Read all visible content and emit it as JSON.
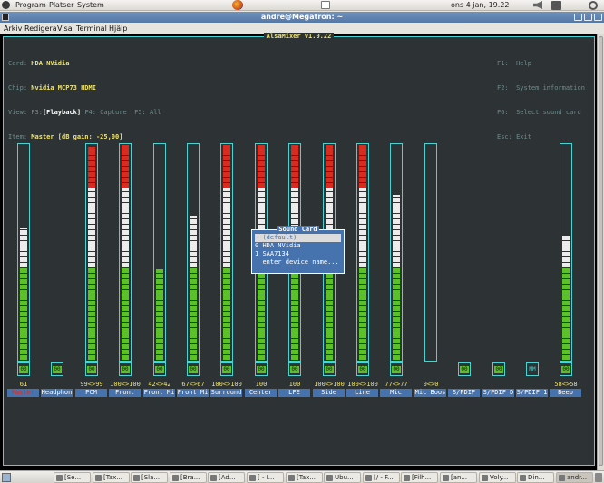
{
  "panel": {
    "menus": [
      "Program",
      "Platser",
      "System"
    ],
    "datetime": "ons  4 jan, 19.22"
  },
  "window": {
    "title": "andre@Megatron: ~"
  },
  "menubar": {
    "items": [
      "Arkiv",
      "Redigera",
      "Visa",
      "Terminal",
      "Hjälp"
    ]
  },
  "mixer": {
    "title": "AlsaMixer v1.0.22",
    "card_label": "Card:",
    "card": "HDA NVidia",
    "chip_label": "Chip:",
    "chip": "Nvidia MCP73 HDMI",
    "view_label": "View:",
    "view_f3": "F3:",
    "view_playback": "[Playback]",
    "view_f4": "F4: Capture",
    "view_f5": "F5: All",
    "item_label": "Item:",
    "item": "Master [dB gain: -25,00]",
    "help": [
      "F1:  Help",
      "F2:  System information",
      "F6:  Select sound card",
      "Esc: Exit"
    ],
    "channels": [
      {
        "name": "Master",
        "volume": "61",
        "level": 0.61,
        "mute": "00",
        "selected": true
      },
      {
        "name": "Headphon",
        "volume": "",
        "level": null,
        "mute": "00"
      },
      {
        "name": "PCM",
        "volume": "99<>99",
        "level": 0.99,
        "mute": "00"
      },
      {
        "name": "Front",
        "volume": "100<>100",
        "level": 1.0,
        "mute": "00"
      },
      {
        "name": "Front Mi",
        "volume": "42<>42",
        "level": 0.42,
        "mute": "00"
      },
      {
        "name": "Front Mi",
        "volume": "67<>67",
        "level": 0.67,
        "mute": "00"
      },
      {
        "name": "Surround",
        "volume": "100<>100",
        "level": 1.0,
        "mute": "00"
      },
      {
        "name": "Center",
        "volume": "100",
        "level": 1.0,
        "mute": "00"
      },
      {
        "name": "LFE",
        "volume": "100",
        "level": 1.0,
        "mute": "00"
      },
      {
        "name": "Side",
        "volume": "100<>100",
        "level": 1.0,
        "mute": "00"
      },
      {
        "name": "Line",
        "volume": "100<>100",
        "level": 1.0,
        "mute": "00"
      },
      {
        "name": "Mic",
        "volume": "77<>77",
        "level": 0.77,
        "mute": "00"
      },
      {
        "name": "Mic Boos",
        "volume": "0<>0",
        "level": 0.0,
        "mute": ""
      },
      {
        "name": "S/PDIF",
        "volume": "",
        "level": null,
        "mute": "00"
      },
      {
        "name": "S/PDIF D",
        "volume": "",
        "level": null,
        "mute": "00"
      },
      {
        "name": "S/PDIF 1",
        "volume": "",
        "level": null,
        "mute": "MM"
      },
      {
        "name": "Beep",
        "volume": "58<>58",
        "level": 0.58,
        "mute": "00"
      }
    ],
    "sound_card_dialog": {
      "title": "Sound Card",
      "options": [
        {
          "index": "-",
          "label": "(default)",
          "selected": true
        },
        {
          "index": "0",
          "label": "HDA NVidia"
        },
        {
          "index": "1",
          "label": "SAA7134"
        },
        {
          "index": "",
          "label": "enter device name..."
        }
      ]
    }
  },
  "taskbar": {
    "items": [
      "[Se...",
      "[Tax...",
      "[Sla...",
      "[Bra...",
      "[Ad...",
      "[ - I...",
      "[Tax...",
      "Ubu...",
      "[/ - F...",
      "[Filh...",
      "[an...",
      "Voly...",
      "Din...",
      "andr..."
    ]
  }
}
